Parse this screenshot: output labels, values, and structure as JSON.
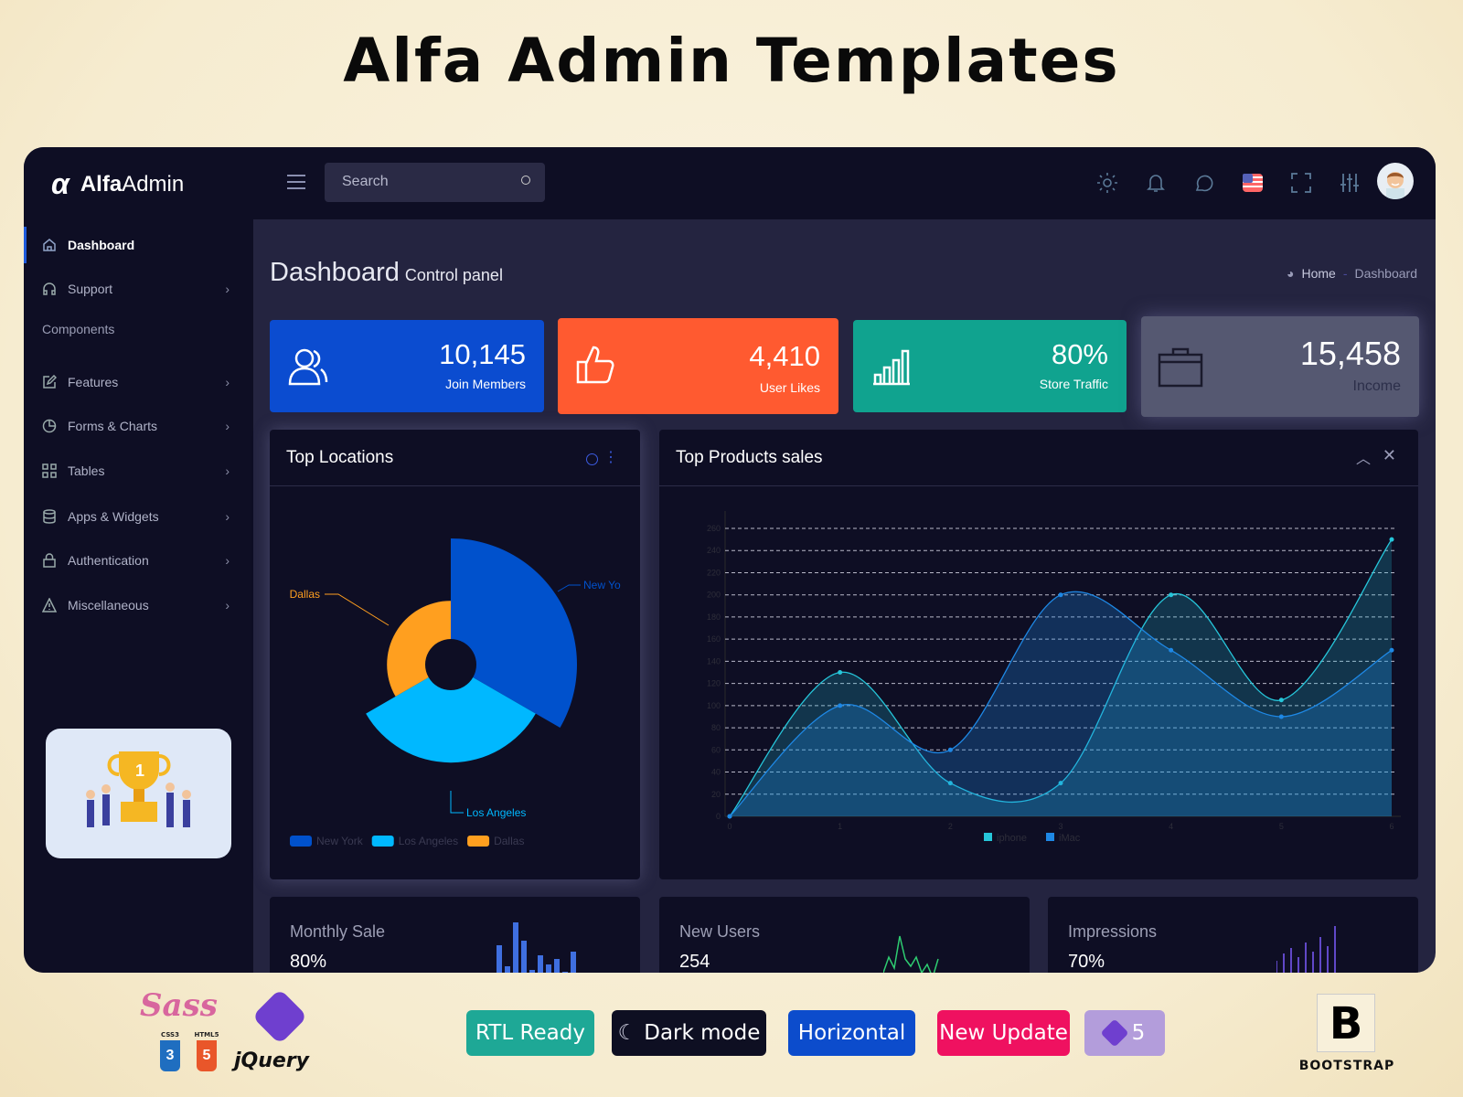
{
  "page_title": "Alfa Admin Templates",
  "header": {
    "logo_bold": "Alfa",
    "logo_light": "Admin",
    "search_placeholder": "Search",
    "icons": [
      "sun-icon",
      "bell-icon",
      "chat-icon",
      "us-flag-icon",
      "fullscreen-icon",
      "sliders-icon"
    ]
  },
  "sidebar": {
    "items": [
      {
        "label": "Dashboard",
        "icon": "home-icon",
        "active": true
      },
      {
        "label": "Support",
        "icon": "headset-icon",
        "chevron": true
      },
      {
        "label": "Components",
        "header": true
      },
      {
        "label": "Features",
        "icon": "edit-icon",
        "chevron": true
      },
      {
        "label": "Forms & Charts",
        "icon": "pie-icon",
        "chevron": true
      },
      {
        "label": "Tables",
        "icon": "grid-icon",
        "chevron": true
      },
      {
        "label": "Apps & Widgets",
        "icon": "database-icon",
        "chevron": true
      },
      {
        "label": "Authentication",
        "icon": "lock-icon",
        "chevron": true
      },
      {
        "label": "Miscellaneous",
        "icon": "warning-icon",
        "chevron": true
      }
    ]
  },
  "main": {
    "title": "Dashboard",
    "subtitle": "Control panel",
    "breadcrumb": {
      "home": "Home",
      "sep": "-",
      "current": "Dashboard"
    },
    "stats": [
      {
        "value": "10,145",
        "label": "Join Members",
        "color": "#0b4cd0",
        "icon": "users-icon"
      },
      {
        "value": "4,410",
        "label": "User Likes",
        "color": "#ff5a30",
        "icon": "thumbs-up-icon"
      },
      {
        "value": "80%",
        "label": "Store Traffic",
        "color": "#10a38f",
        "icon": "bar-chart-icon"
      },
      {
        "value": "15,458",
        "label": "Income",
        "color": "#555871",
        "icon": "briefcase-icon"
      }
    ],
    "locations": {
      "title": "Top Locations"
    },
    "products": {
      "title": "Top Products sales"
    },
    "mini": [
      {
        "title": "Monthly Sale",
        "value": "80%"
      },
      {
        "title": "New Users",
        "value": "254"
      },
      {
        "title": "Impressions",
        "value": "70%"
      }
    ]
  },
  "chart_data": [
    {
      "type": "pie",
      "variant": "nightingale-rose",
      "title": "Top Locations",
      "categories": [
        "New York",
        "Los Angeles",
        "Dallas"
      ],
      "values": [
        100,
        72,
        38
      ],
      "colors": [
        "#0051cc",
        "#00b8ff",
        "#ff9f1f"
      ],
      "labels": [
        "New Yo",
        "Los Angeles",
        "Dallas"
      ],
      "legend": "bottom-left"
    },
    {
      "type": "area",
      "title": "Top Products sales",
      "x": [
        0,
        1,
        2,
        3,
        4,
        5,
        6
      ],
      "series": [
        {
          "name": "iphone",
          "values": [
            0,
            130,
            30,
            30,
            200,
            105,
            250
          ],
          "color": "#26c6da"
        },
        {
          "name": "iMac",
          "values": [
            0,
            100,
            60,
            200,
            150,
            90,
            150
          ],
          "color": "#1e88e5"
        }
      ],
      "ylim": [
        0,
        260
      ],
      "yticks": [
        0,
        20,
        40,
        60,
        80,
        100,
        120,
        140,
        160,
        180,
        200,
        220,
        240,
        260
      ],
      "grid": true,
      "legend": "bottom-center"
    }
  ],
  "footer": {
    "badges": [
      {
        "label": "RTL Ready",
        "color": "#1ea896"
      },
      {
        "label": "Dark mode",
        "color": "#0e0f22"
      },
      {
        "label": "Horizontal",
        "color": "#0c4ccc"
      },
      {
        "label": "New Update",
        "color": "#ef1160"
      },
      {
        "label": "5",
        "color": "#b39ddb"
      }
    ],
    "tech_logos": [
      "Sass",
      "CSS3",
      "HTML5",
      "Bootstrap",
      "jQuery"
    ],
    "brand": "BOOTSTRAP"
  }
}
